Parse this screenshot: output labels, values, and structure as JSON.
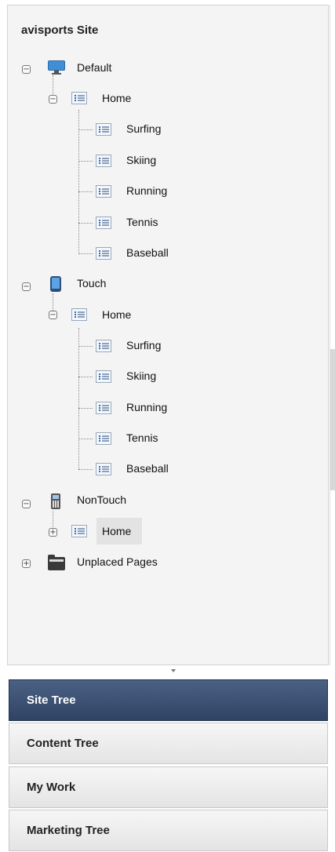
{
  "site_title": "avisports Site",
  "tree": {
    "default": {
      "label": "Default",
      "icon": "monitor-icon",
      "home": "Home",
      "children": [
        "Surfing",
        "Skiing",
        "Running",
        "Tennis",
        "Baseball"
      ]
    },
    "touch": {
      "label": "Touch",
      "icon": "tablet-icon",
      "home": "Home",
      "children": [
        "Surfing",
        "Skiing",
        "Running",
        "Tennis",
        "Baseball"
      ]
    },
    "nontouch": {
      "label": "NonTouch",
      "icon": "phone-icon",
      "home": "Home"
    },
    "unplaced": {
      "label": "Unplaced Pages",
      "icon": "folder-icon"
    }
  },
  "tabs": [
    {
      "label": "Site Tree",
      "active": true
    },
    {
      "label": "Content Tree",
      "active": false
    },
    {
      "label": "My Work",
      "active": false
    },
    {
      "label": "Marketing Tree",
      "active": false
    }
  ],
  "colors": {
    "active_tab": "#3a4f73",
    "panel_bg": "#f4f4f4"
  }
}
